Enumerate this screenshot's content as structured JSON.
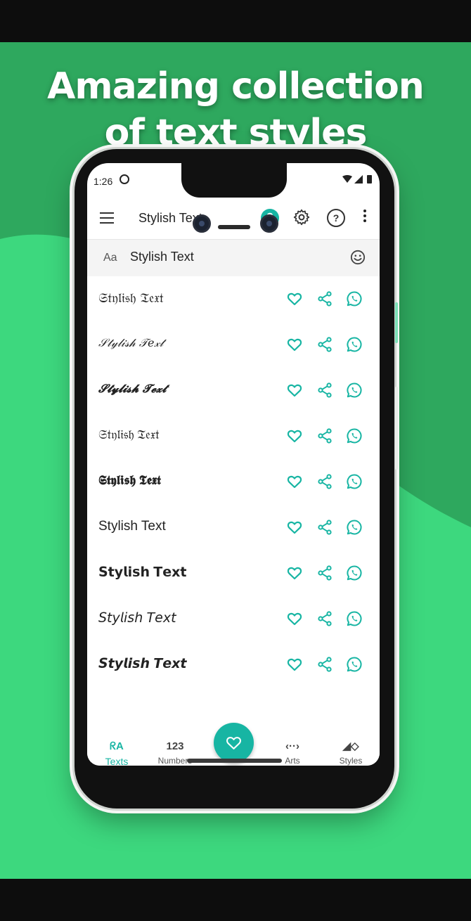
{
  "promo": {
    "headline_line1": "Amazing collection",
    "headline_line2": "of text styles"
  },
  "status_bar": {
    "time": "1:26"
  },
  "app_bar": {
    "title": "Stylish Text"
  },
  "input": {
    "prefix": "Aa",
    "value": "Stylish Text"
  },
  "rows": [
    {
      "text": "𝔖𝔱𝔶𝔩𝔦𝔰𝔥 𝔗𝔢𝔵𝔱"
    },
    {
      "text": "𝒮𝓉𝓎𝓁𝒾𝓈𝒽 𝒯𝑒𝓍𝓉"
    },
    {
      "text": "𝓢𝓽𝔂𝓵𝓲𝓼𝓱 𝓣𝓮𝔁𝓽"
    },
    {
      "text": "𝔖𝔱𝔶𝔩𝔦𝔰𝔥 𝔗𝔢𝔵𝔱"
    },
    {
      "text": "𝕾𝖙𝖞𝖑𝖎𝖘𝖍 𝕿𝖊𝖝𝖙"
    },
    {
      "text": "Stylish Text"
    },
    {
      "text": "𝗦𝘁𝘆𝗹𝗶𝘀𝗵 𝗧𝗲𝘅𝘁"
    },
    {
      "text": "𝘚𝘵𝘺𝘭𝘪𝘴𝘩 𝘛𝘦𝘹𝘵"
    },
    {
      "text": "𝙎𝙩𝙮𝙡𝙞𝙨𝙝 𝙏𝙚𝙭𝙩"
    }
  ],
  "bottom_nav": {
    "items": [
      {
        "label": "Texts",
        "glyph": "ᖇA"
      },
      {
        "label": "Numbers",
        "glyph": "123"
      },
      {
        "label": "Arts",
        "glyph": "‹··›"
      },
      {
        "label": "Styles",
        "glyph": "◢◇"
      }
    ]
  },
  "colors": {
    "accent": "#17b5a3",
    "background_dark_green": "#2ea85e",
    "background_light_green": "#3dd87e"
  },
  "icons": {
    "row_actions": [
      "heart-icon",
      "share-icon",
      "whatsapp-icon"
    ],
    "app_bar": [
      "menu-icon",
      "dollar-icon",
      "gear-icon",
      "help-icon",
      "more-vert-icon"
    ]
  }
}
